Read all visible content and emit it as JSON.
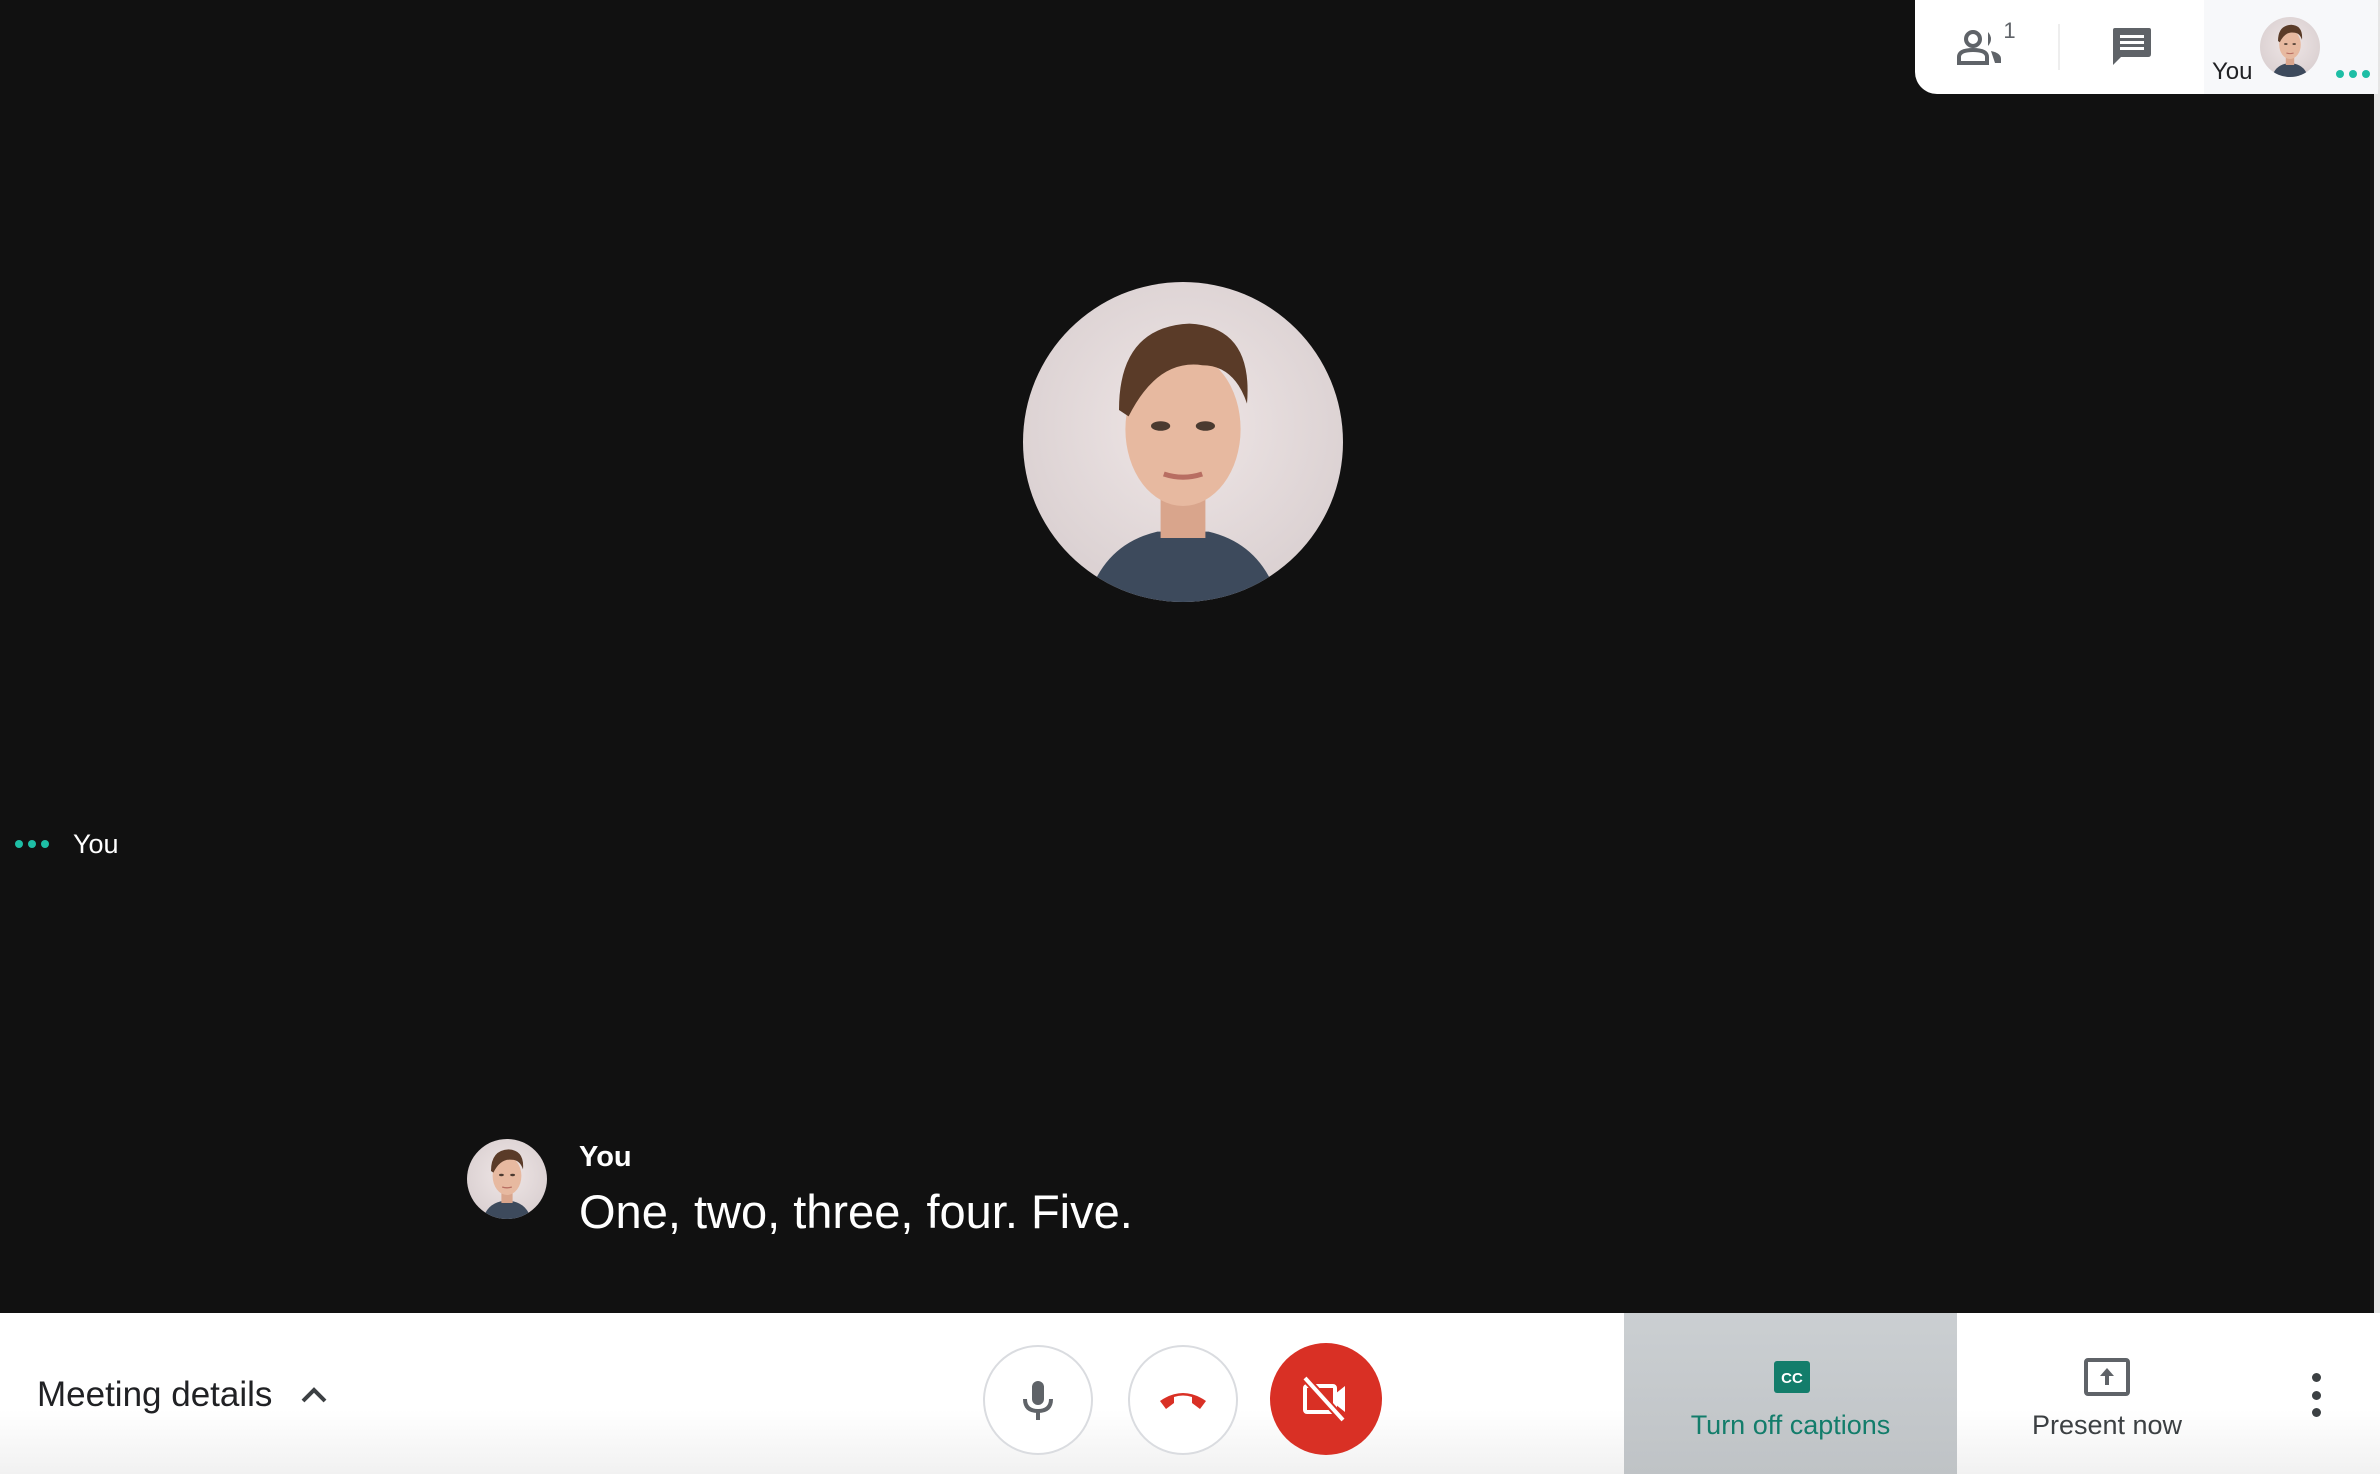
{
  "topbar": {
    "participants_icon": "people-icon",
    "participants_count": "1",
    "chat_icon": "chat-icon",
    "self_label": "You"
  },
  "stage": {
    "tile_label": "You"
  },
  "caption": {
    "speaker": "You",
    "text": "One, two, three, four. Five."
  },
  "bottombar": {
    "meeting_details": "Meeting details",
    "captions_label": "Turn off captions",
    "present_label": "Present now"
  },
  "colors": {
    "accent": "#137d6b",
    "speaking_dots": "#1ebea5",
    "camera_off": "#d93025",
    "background": "#111111"
  }
}
